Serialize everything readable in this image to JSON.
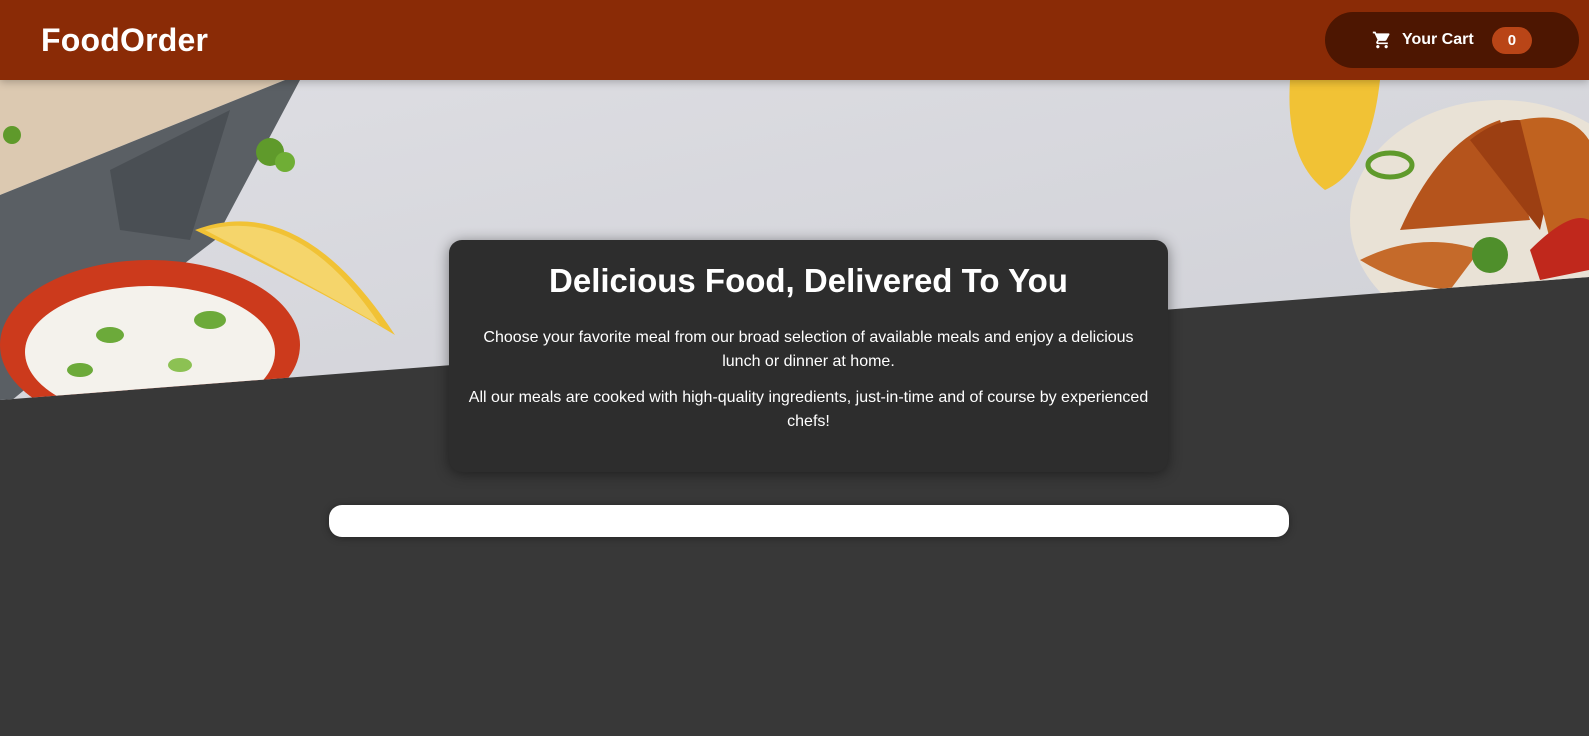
{
  "header": {
    "brand": "FoodOrder",
    "cart_label": "Your Cart",
    "cart_count": "0",
    "cart_icon": "cart-icon"
  },
  "summary": {
    "title": "Delicious Food, Delivered To You",
    "paragraph_1": "Choose your favorite meal from our broad selection of available meals and enjoy a delicious lunch or dinner at home.",
    "paragraph_2": "All our meals are cooked with high-quality ingredients, just-in-time and of course by experienced chefs!"
  },
  "colors": {
    "header_bg": "#8a2b06",
    "cart_button_bg": "#4d1601",
    "cart_badge_bg": "#b94517",
    "page_bg": "#383838",
    "summary_bg": "#2d2d2d",
    "meals_panel_bg": "#ffffff"
  }
}
